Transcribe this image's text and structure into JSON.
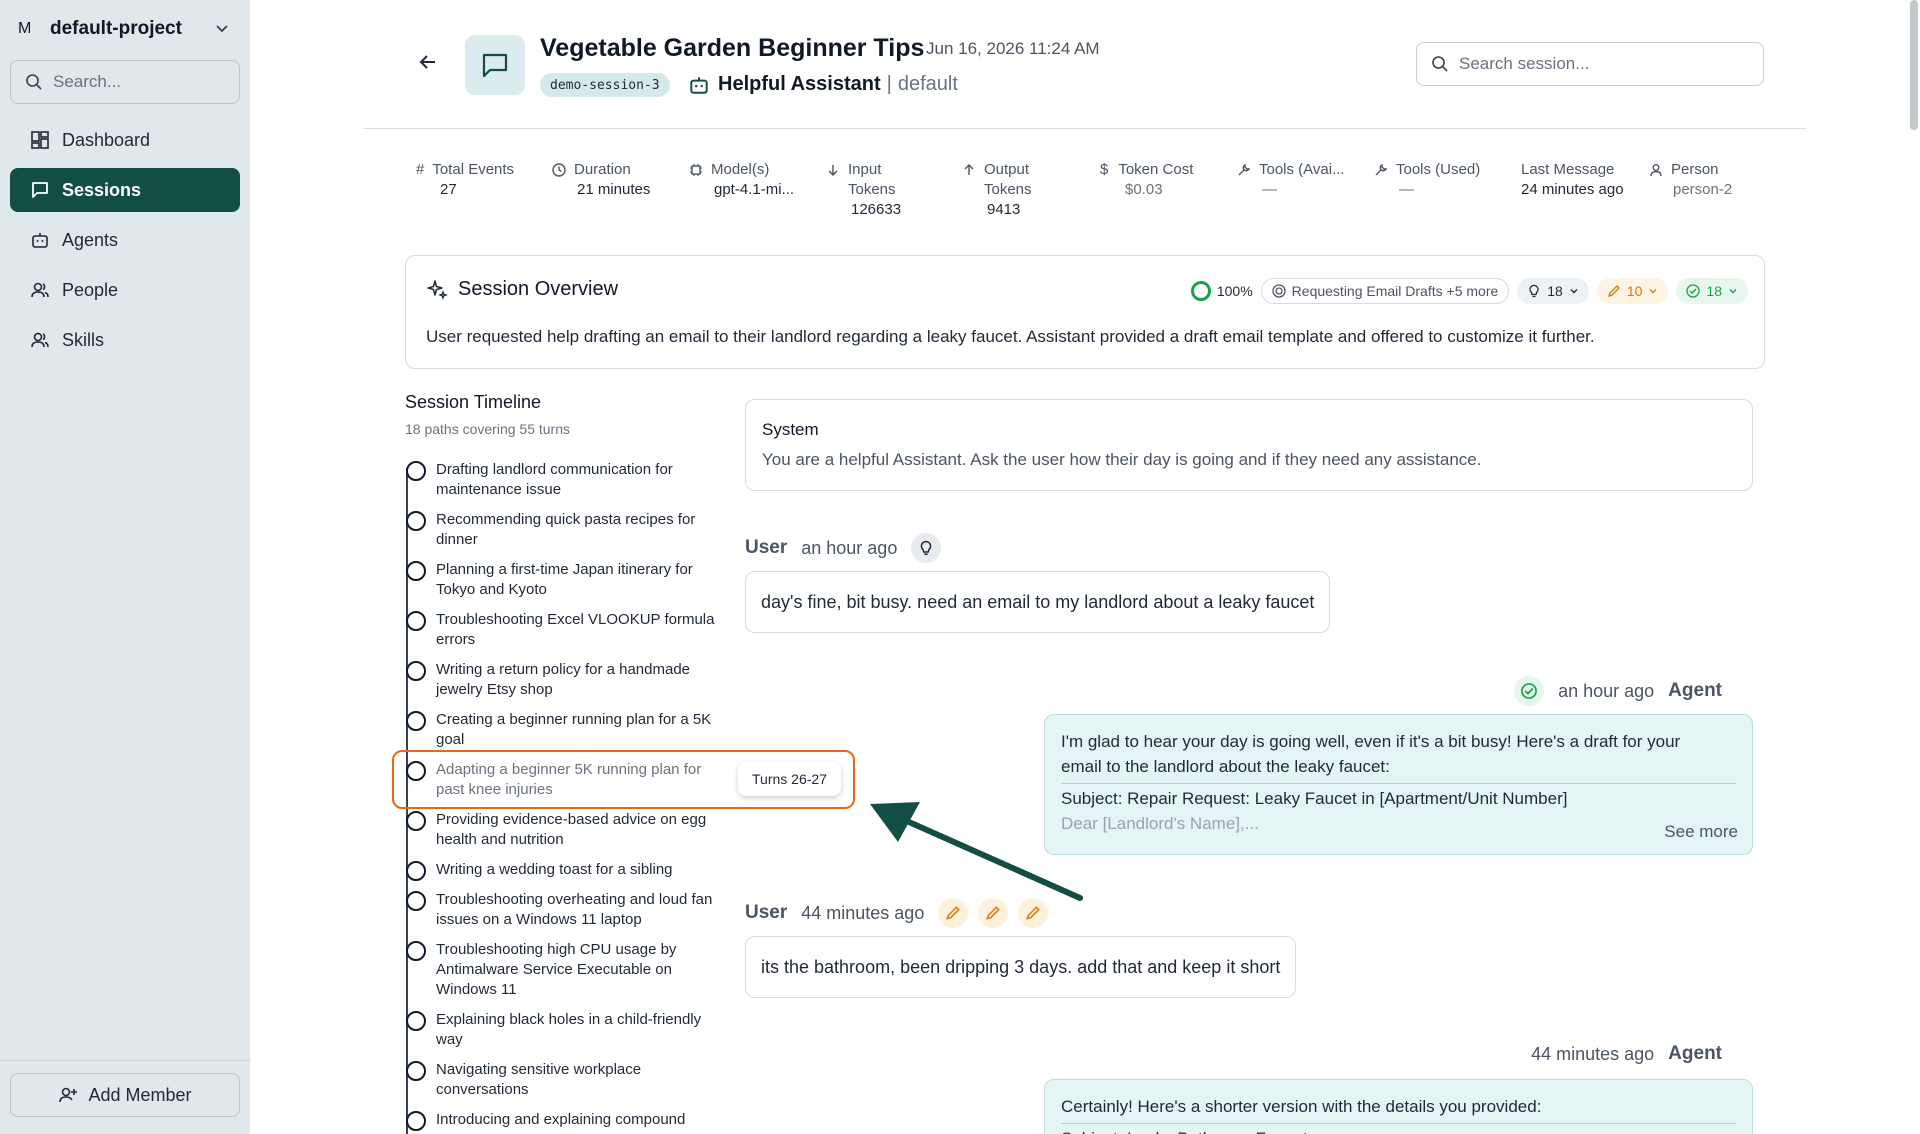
{
  "sidebar": {
    "project_initial": "M",
    "project_name": "default-project",
    "search_placeholder": "Search...",
    "items": [
      {
        "label": "Dashboard",
        "icon": "dashboard-icon",
        "active": false
      },
      {
        "label": "Sessions",
        "icon": "message-square-icon",
        "active": true
      },
      {
        "label": "Agents",
        "icon": "bot-icon",
        "active": false
      },
      {
        "label": "People",
        "icon": "users-icon",
        "active": false
      },
      {
        "label": "Skills",
        "icon": "users-icon",
        "active": false
      }
    ],
    "add_member_label": "Add Member"
  },
  "header": {
    "title": "Vegetable Garden Beginner Tips",
    "datetime": "Jun 16, 2026 11:24 AM",
    "session_id": "demo-session-3",
    "agent_name": "Helpful Assistant",
    "agent_sep": "|",
    "agent_env": "default",
    "search_placeholder": "Search session..."
  },
  "stats": [
    {
      "label": "Total Events",
      "value": "27"
    },
    {
      "label": "Duration",
      "value": "21 minutes"
    },
    {
      "label": "Model(s)",
      "value": "gpt-4.1-mi..."
    },
    {
      "label": "Input Tokens",
      "value": "126633"
    },
    {
      "label": "Output Tokens",
      "value": "9413"
    },
    {
      "label": "Token Cost",
      "value": "$0.03"
    },
    {
      "label": "Tools (Avai...",
      "value": "—"
    },
    {
      "label": "Tools (Used)",
      "value": "—"
    },
    {
      "label": "Last Message",
      "value": "24 minutes ago"
    },
    {
      "label": "Person",
      "value": "person-2"
    }
  ],
  "overview": {
    "title": "Session Overview",
    "score": "100%",
    "topic_chip": "Requesting Email Drafts +5 more",
    "ideas_count": "18",
    "edits_count": "10",
    "checks_count": "18",
    "summary": "User requested help drafting an email to their landlord regarding a leaky faucet. Assistant provided a draft email template and offered to customize it further."
  },
  "timeline": {
    "title": "Session Timeline",
    "subtitle": "18 paths covering 55 turns",
    "items": [
      "Drafting landlord communication for maintenance issue",
      "Recommending quick pasta recipes for dinner",
      "Planning a first-time Japan itinerary for Tokyo and Kyoto",
      "Troubleshooting Excel VLOOKUP formula errors",
      "Writing a return policy for a handmade jewelry Etsy shop",
      "Creating a beginner running plan for a 5K goal",
      "Adapting a beginner 5K running plan for past knee injuries",
      "Providing evidence-based advice on egg health and nutrition",
      "Writing a wedding toast for a sibling",
      "Troubleshooting overheating and loud fan issues on a Windows 11 laptop",
      "Troubleshooting high CPU usage by Antimalware Service Executable on Windows 11",
      "Explaining black holes in a child-friendly way",
      "Navigating sensitive workplace conversations",
      "Introducing and explaining compound"
    ],
    "tooltip": "Turns 26-27"
  },
  "chat": {
    "system_label": "System",
    "system_text": "You are a helpful Assistant. Ask the user how their day is going and if they need any assistance.",
    "messages": [
      {
        "role": "User",
        "time": "an hour ago",
        "text": "day's fine, bit busy. need an email to my landlord about a leaky faucet"
      },
      {
        "role": "Agent",
        "time": "an hour ago",
        "line1": "I'm glad to hear your day is going well, even if it's a bit busy! Here's a draft for your",
        "line2": "email to the landlord about the leaky faucet:",
        "line3": "Subject: Repair Request: Leaky Faucet in [Apartment/Unit Number]",
        "line4": "Dear [Landlord's Name],...",
        "see_more": "See more"
      },
      {
        "role": "User",
        "time": "44 minutes ago",
        "text": "its the bathroom, been dripping 3 days. add that and keep it short"
      },
      {
        "role": "Agent",
        "time": "44 minutes ago",
        "line1": "Certainly! Here's a shorter version with the details you provided:",
        "line2": "Subject: Leaky Bathroom Faucet"
      }
    ]
  },
  "colors": {
    "sidebar_bg": "#dfe8ea",
    "active_nav": "#134e44",
    "highlight_orange": "#e46a17",
    "arrow_green": "#134e44",
    "agent_bubble": "#e5f5f6"
  }
}
